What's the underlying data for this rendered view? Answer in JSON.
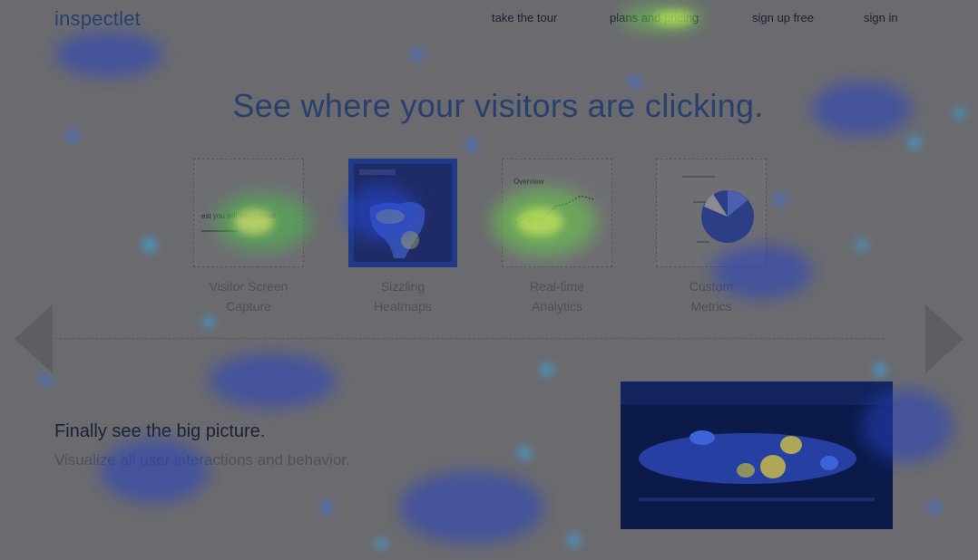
{
  "header": {
    "logo": "inspectlet",
    "nav": [
      {
        "label": "take the tour"
      },
      {
        "label": "plans and pricing"
      },
      {
        "label": "sign up free"
      },
      {
        "label": "sign in"
      }
    ]
  },
  "hero": {
    "title": "See where your visitors are clicking."
  },
  "features": [
    {
      "label_line1": "Visitor Screen",
      "label_line2": "Capture",
      "thumb_text": "est you will test a small"
    },
    {
      "label_line1": "Sizzling",
      "label_line2": "Heatmaps"
    },
    {
      "label_line1": "Real-time",
      "label_line2": "Analytics",
      "thumb_text": "Overview"
    },
    {
      "label_line1": "Custom",
      "label_line2": "Metrics"
    }
  ],
  "carousel": {
    "prev_icon": "triangle-left-arrow",
    "next_icon": "triangle-right-arrow"
  },
  "section": {
    "title": "Finally see the big picture.",
    "subtitle": "Visualize all user interactions and behavior."
  },
  "colors": {
    "background": "#6b6b6f",
    "brand_blue": "#27406e",
    "heat_low": "#2a4dff",
    "heat_mid": "#7fe04a",
    "heat_high": "#e8e060"
  }
}
